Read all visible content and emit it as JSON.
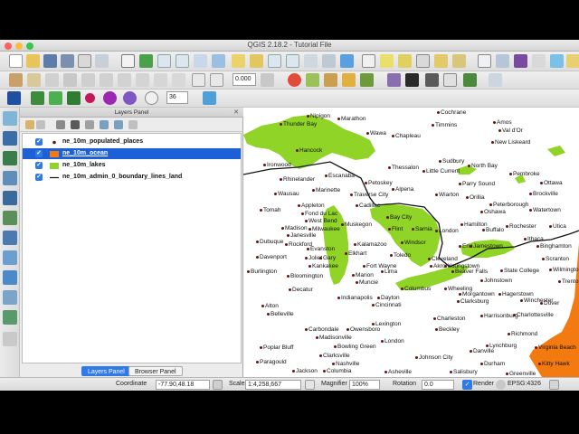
{
  "window": {
    "title": "QGIS 2.18.2 - Tutorial File"
  },
  "toolbar": {
    "zoom_value": "0.000",
    "size_value": "36"
  },
  "layers_panel": {
    "title": "Layers Panel",
    "close_glyph": "✕",
    "layers": [
      {
        "name": "ne_10m_populated_places",
        "checked": true,
        "symbol": "dot",
        "selected": false
      },
      {
        "name": "ne_10m_ocean",
        "checked": true,
        "symbol": "orange-fill",
        "selected": true
      },
      {
        "name": "ne_10m_lakes",
        "checked": true,
        "symbol": "green-fill",
        "selected": false
      },
      {
        "name": "ne_10m_admin_0_boundary_lines_land",
        "checked": true,
        "symbol": "line",
        "selected": false
      }
    ],
    "tabs": [
      "Layers Panel",
      "Browser Panel"
    ]
  },
  "map": {
    "colors": {
      "lakes": "#8fd427",
      "ocean": "#f27a10",
      "places": "#6b1212",
      "boundary": "#111111"
    },
    "places": [
      "Nipigon",
      "Marathon",
      "Thunder Bay",
      "Wawa",
      "Timmins",
      "Cochrane",
      "Amos",
      "Val d'Or",
      "New Liskeard",
      "Chapleau",
      "Hancock",
      "Sudbury",
      "North Bay",
      "Ironwood",
      "Thessalon",
      "Little Current",
      "Pembroke",
      "Rhinelander",
      "Escanaba",
      "Petoskey",
      "Alpena",
      "Parry Sound",
      "Ottawa",
      "Marinette",
      "Traverse City",
      "Wiarton",
      "Orillia",
      "Brockville",
      "Wausau",
      "Appleton",
      "Cadillac",
      "Peterborough",
      "Oshawa",
      "Watertown",
      "Tomah",
      "Fond du Lac",
      "West Bend",
      "Muskegon",
      "Bay City",
      "Hamilton",
      "Rochester",
      "Utica",
      "Madison",
      "Milwaukee",
      "Flint",
      "Sarnia",
      "London",
      "Buffalo",
      "Ithaca",
      "Janesville",
      "Rockford",
      "Kalamazoo",
      "Windsor",
      "Erie",
      "Jamestown",
      "Binghamton",
      "Dubuque",
      "Evanston",
      "Elkhart",
      "Toledo",
      "Davenport",
      "Joliet",
      "Gary",
      "Cleveland",
      "Scranton",
      "Kankakee",
      "Fort Wayne",
      "Akron",
      "Youngstown",
      "Burlington",
      "Bloomington",
      "Marion",
      "Lima",
      "Beaver Falls",
      "State College",
      "Muncie",
      "Wilmington",
      "Trenton",
      "Decatur",
      "Columbus",
      "Wheeling",
      "Johnstown",
      "Morgantown",
      "Hagerstown",
      "Indianapolis",
      "Dayton",
      "Clarksburg",
      "Winchester",
      "Dover",
      "Alton",
      "Cincinnati",
      "Belleville",
      "Charleston",
      "Harrisonburg",
      "Carbondale",
      "Owensboro",
      "Lexington",
      "Beckley",
      "Charlottesville",
      "Madisonville",
      "Richmond",
      "Lynchburg",
      "Poplar Bluff",
      "Bowling Green",
      "London",
      "Virginia Beach",
      "Danville",
      "Clarksville",
      "Johnson City",
      "Paragould",
      "Nashville",
      "Durham",
      "Kitty Hawk",
      "Jackson",
      "Columbia",
      "Asheville",
      "Salisbury",
      "Greenville"
    ]
  },
  "status": {
    "coordinate_label": "Coordinate",
    "coordinate_value": "-77.90,48.18",
    "scale_label": "Scale",
    "scale_value": "1:4,258,667",
    "magnifier_label": "Magnifier",
    "magnifier_value": "100%",
    "rotation_label": "Rotation",
    "rotation_value": "0.0",
    "render_label": "Render",
    "crs_label": "EPSG:4326"
  }
}
